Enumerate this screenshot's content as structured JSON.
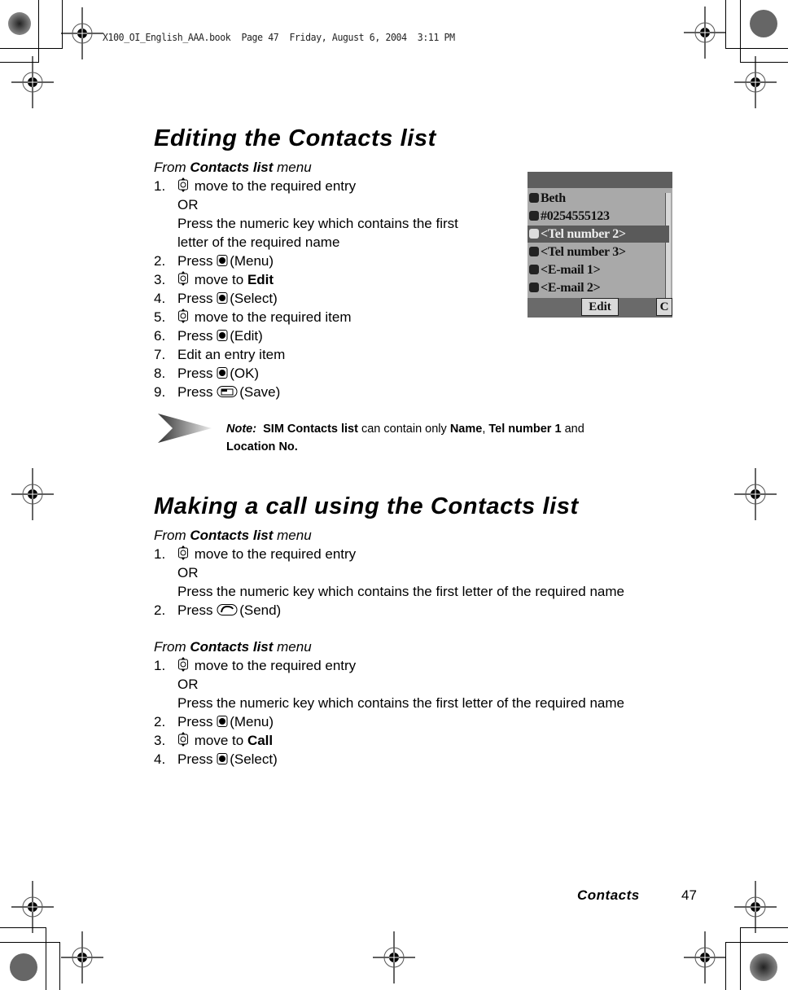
{
  "print_slug": "X100_OI_English_AAA.book  Page 47  Friday, August 6, 2004  3:11 PM",
  "section1": {
    "title": "Editing the Contacts list",
    "from": {
      "prefix": "From",
      "bold": "Contacts list",
      "suffix": "menu"
    },
    "steps": [
      {
        "num": "1.",
        "icon": "navigation-key-icon",
        "text": "move to the required entry"
      },
      {
        "num": "",
        "text": "OR"
      },
      {
        "num": "",
        "text": "Press the numeric key which contains the first"
      },
      {
        "num": "",
        "text": "letter of the required name"
      },
      {
        "num": "2.",
        "pre": "Press",
        "icon": "center-key-icon",
        "text": "(Menu)"
      },
      {
        "num": "3.",
        "icon": "navigation-key-icon",
        "text": "move to",
        "bold": "Edit"
      },
      {
        "num": "4.",
        "pre": "Press",
        "icon": "center-key-icon",
        "text": "(Select)"
      },
      {
        "num": "5.",
        "icon": "navigation-key-icon",
        "text": "move to the required item"
      },
      {
        "num": "6.",
        "pre": "Press",
        "icon": "center-key-icon",
        "text": "(Edit)"
      },
      {
        "num": "7.",
        "text": "Edit an entry item"
      },
      {
        "num": "8.",
        "pre": "Press",
        "icon": "center-key-icon",
        "text": "(OK)"
      },
      {
        "num": "9.",
        "pre": "Press",
        "icon": "soft-key-icon",
        "text": "(Save)"
      }
    ]
  },
  "phone_screen": {
    "rows": [
      {
        "icon": "name-icon",
        "text": "Beth"
      },
      {
        "icon": "phone-icon",
        "text": "#0254555123"
      },
      {
        "icon": "phone-icon",
        "text": "<Tel number 2>",
        "selected": true
      },
      {
        "icon": "phone-icon",
        "text": "<Tel number 3>"
      },
      {
        "icon": "email-icon",
        "text": "<E-mail 1>"
      },
      {
        "icon": "email-icon",
        "text": "<E-mail 2>"
      }
    ],
    "softkey_center": "Edit",
    "softkey_right": "C"
  },
  "note": {
    "label": "Note:",
    "parts": [
      {
        "b": "SIM Contacts list"
      },
      {
        "t": " can contain only "
      },
      {
        "b": "Name"
      },
      {
        "t": ", "
      },
      {
        "b": "Tel number 1"
      },
      {
        "t": " and"
      }
    ],
    "line2": "Location No."
  },
  "section2": {
    "title": "Making a call using the Contacts list",
    "from": {
      "prefix": "From",
      "bold": "Contacts list",
      "suffix": "menu"
    },
    "stepsA": [
      {
        "num": "1.",
        "icon": "navigation-key-icon",
        "text": "move to the required entry"
      },
      {
        "num": "",
        "text": "OR"
      },
      {
        "num": "",
        "text": "Press the numeric key which contains the first letter of the required name"
      },
      {
        "num": "2.",
        "pre": "Press",
        "icon": "send-key-icon",
        "text": "(Send)"
      }
    ],
    "from2": {
      "prefix": "From",
      "bold": "Contacts list",
      "suffix": "menu"
    },
    "stepsB": [
      {
        "num": "1.",
        "icon": "navigation-key-icon",
        "text": "move to the required entry"
      },
      {
        "num": "",
        "text": "OR"
      },
      {
        "num": "",
        "text": "Press the numeric key which contains the first letter of the required name"
      },
      {
        "num": "2.",
        "pre": "Press",
        "icon": "center-key-icon",
        "text": "(Menu)"
      },
      {
        "num": "3.",
        "icon": "navigation-key-icon",
        "text": "move to",
        "bold": "Call"
      },
      {
        "num": "4.",
        "pre": "Press",
        "icon": "center-key-icon",
        "text": "(Select)"
      }
    ]
  },
  "footer": {
    "chapter": "Contacts",
    "page": "47"
  }
}
